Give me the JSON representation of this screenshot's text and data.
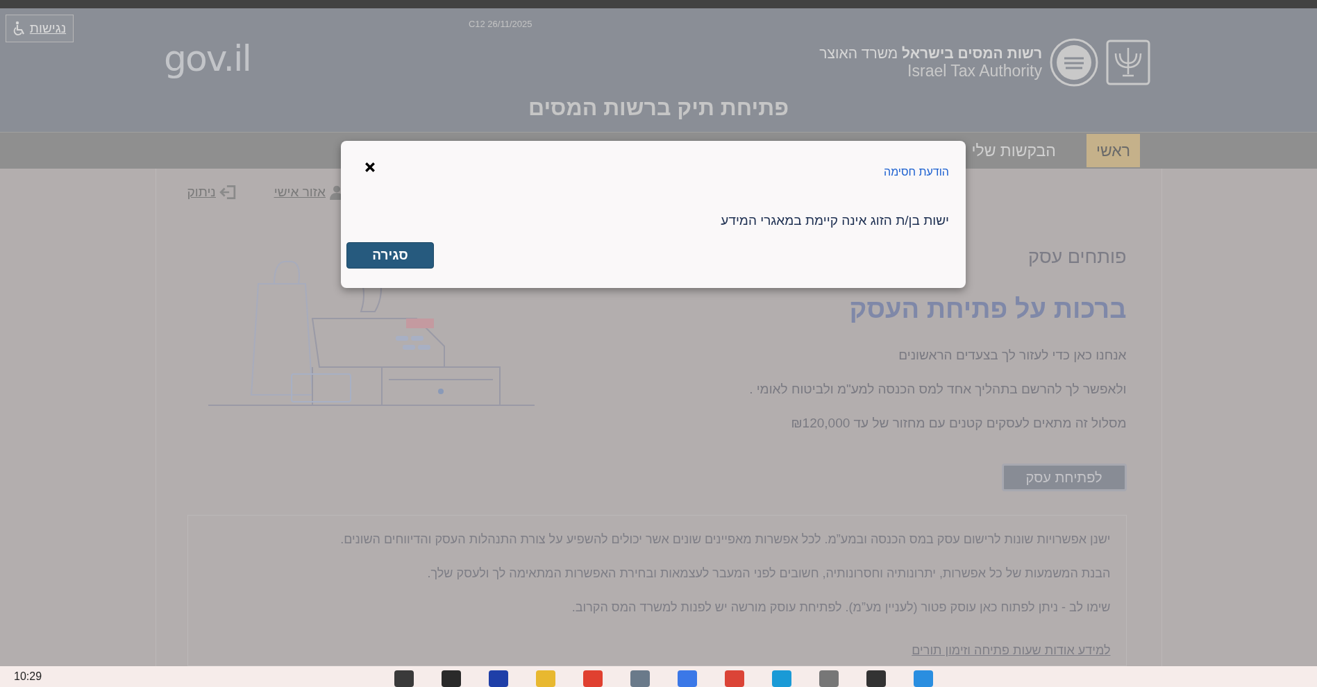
{
  "header": {
    "accessibility_button": "נגישות",
    "version_date": "C12 26/11/2025",
    "gov_logo": "gov.il",
    "authority_name": "**רשות המסים בישראל** משרד האוצר",
    "authority_name_en": "Israel Tax Authority",
    "page_title": "פתיחת תיק ברשות המסים"
  },
  "nav": [
    {
      "label": "ראשי",
      "selected": true
    },
    {
      "label": "הבקשות שלי",
      "selected": false
    }
  ],
  "user_links": [
    {
      "kind": "personal",
      "label": "אזור אישי"
    },
    {
      "kind": "logout",
      "label": "ניתוק"
    }
  ],
  "intro": {
    "subtitle": "פותחים עסק",
    "heading": "ברכות על פתיחת העסק",
    "paragraphs": [
      "אנחנו כאן כדי לעזור לך בצעדים הראשונים",
      "ולאפשר לך להרשם בתהליך אחד למס הכנסה למע\"מ ולביטוח לאומי .",
      "מסלול זה מתאים לעסקים קטנים עם מחזור של עד ₪120,000"
    ],
    "button": "לפתיחת עסק"
  },
  "info_box": {
    "paragraphs": [
      "ישנן אפשרויות שונות לרישום עסק במס הכנסה ובמע”מ. לכל אפשרות מאפיינים שונים אשר יכולים להשפיע על צורת התנהלות העסק והדיווחים השונים.",
      "הבנת המשמעות של כל אפשרות, יתרונותיה וחסרונותיה, חשובים לפני המעבר לעצמאות ובחירת האפשרות המתאימה לך ולעסק שלך.",
      "שימו לב - ניתן לפתוח כאן עוסק פטור (לעניין מע”מ). לפתיחת עוסק מורשה יש לפנות למשרד המס הקרוב."
    ],
    "link": "למידע אודות שעות פתיחה וזימון תורים"
  },
  "dialog": {
    "title": "הודעת חסימה",
    "message": "ישות בן/ת הזוג אינה קיימת במאגרי המידע",
    "close_button": "סגירה"
  },
  "taskbar": {
    "time": "10:29"
  }
}
